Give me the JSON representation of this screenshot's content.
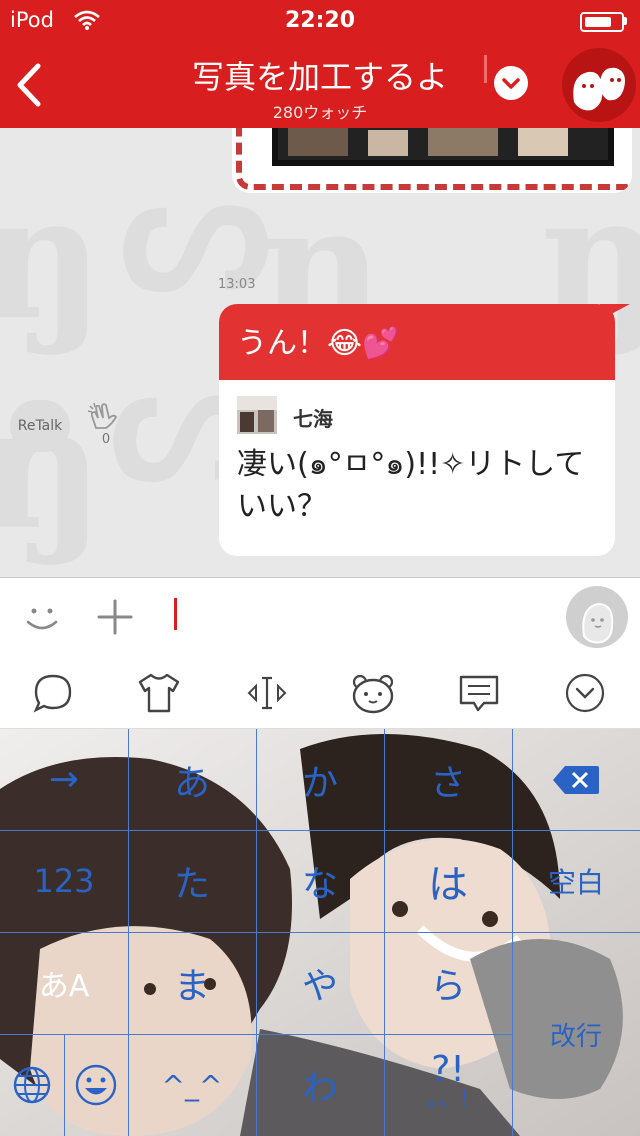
{
  "status_bar": {
    "carrier": "iPod",
    "time": "22:20"
  },
  "header": {
    "title": "写真を加工するよ",
    "subtitle": "280ウォッチ",
    "colors": {
      "brand": "#d81e1e"
    }
  },
  "chat": {
    "timestamp": "13:03",
    "message": {
      "text": "うん！😂💕",
      "quote_author": "七海",
      "quote_text": "凄い(๑°ㅁ°๑)!!✧リトしていい？"
    },
    "retalk_label": "ReTalk",
    "clap_count": "0"
  },
  "toolbar": {
    "icons": [
      "speech-bubble-icon",
      "tshirt-icon",
      "cursor-move-icon",
      "bear-face-icon",
      "message-icon",
      "collapse-icon"
    ]
  },
  "keyboard": {
    "rows": [
      [
        "→",
        "あ",
        "か",
        "さ",
        "⌫"
      ],
      [
        "123",
        "た",
        "な",
        "は",
        "空白"
      ],
      [
        "あA",
        "ま",
        "や",
        "ら",
        "改行"
      ],
      [
        "🌐",
        "☺",
        "^_^",
        "わ",
        "?!"
      ]
    ],
    "punct": "。、!",
    "colors": {
      "key_text": "#2a63c4",
      "grid": "#4a7ad0"
    }
  }
}
